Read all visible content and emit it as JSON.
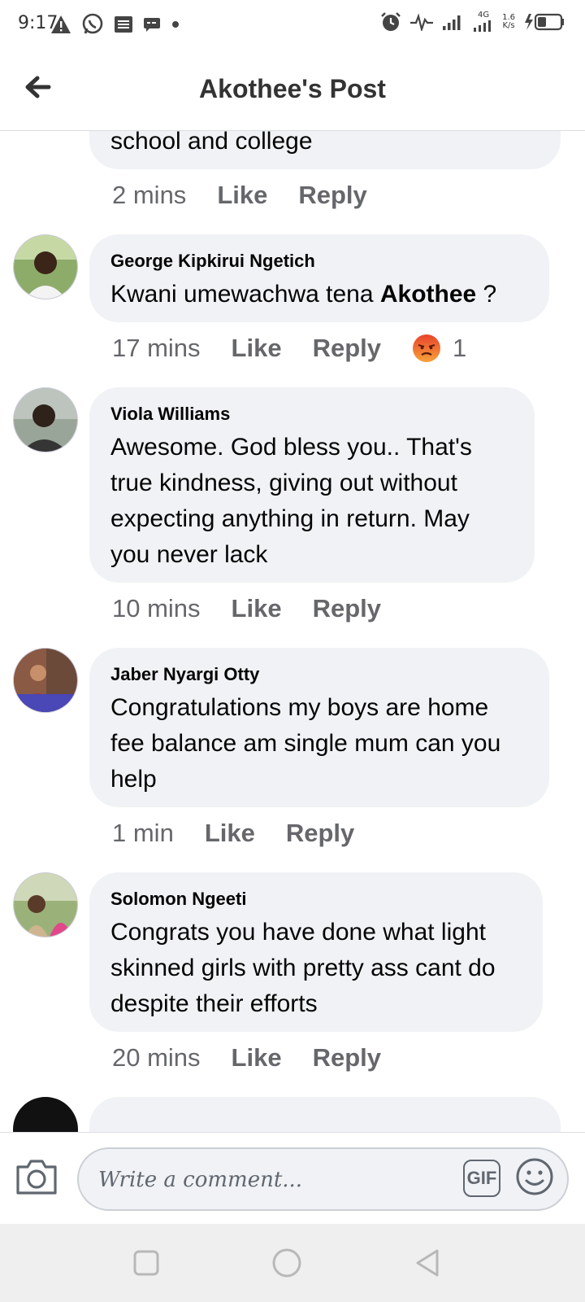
{
  "status_bar": {
    "time": "9:17",
    "left_icons": [
      "warning-icon",
      "whatsapp-icon",
      "news-icon",
      "message-icon",
      "dot-icon"
    ],
    "right_icons": [
      "alarm-icon",
      "activity-icon",
      "signal-icon",
      "signal-4g-icon",
      "battery-charging-icon"
    ],
    "network_label": "4G",
    "speed_value": "1.6",
    "speed_unit": "K/s"
  },
  "header": {
    "title": "Akothee's Post",
    "back_icon": "back-arrow-icon"
  },
  "partial_comment": {
    "text": "school and college",
    "time": "2 mins",
    "like_label": "Like",
    "reply_label": "Reply"
  },
  "comments": [
    {
      "author": "George Kipkirui Ngetich",
      "text_before": "Kwani umewachwa tena ",
      "mention": "Akothee",
      "text_after": " ?",
      "time": "17 mins",
      "like_label": "Like",
      "reply_label": "Reply",
      "reaction_icon": "angry-reaction-icon",
      "reaction_count": "1"
    },
    {
      "author": "Viola Williams",
      "text": "Awesome. God bless you..  That's true kindness, giving out without expecting anything in return. May you never lack",
      "time": "10 mins",
      "like_label": "Like",
      "reply_label": "Reply"
    },
    {
      "author": "Jaber Nyargi Otty",
      "text": "Congratulations my boys are home fee balance am single mum can you help",
      "time": "1 min",
      "like_label": "Like",
      "reply_label": "Reply"
    },
    {
      "author": "Solomon Ngeeti",
      "text": "Congrats you have done what light skinned girls with pretty ass cant do despite their efforts",
      "time": "20 mins",
      "like_label": "Like",
      "reply_label": "Reply"
    }
  ],
  "composer": {
    "placeholder": "Write a comment...",
    "gif_label": "GIF",
    "camera_icon": "camera-icon",
    "emoji_icon": "emoji-icon"
  },
  "nav_bar": {
    "icons": [
      "recent-apps-icon",
      "home-icon",
      "back-icon"
    ]
  }
}
